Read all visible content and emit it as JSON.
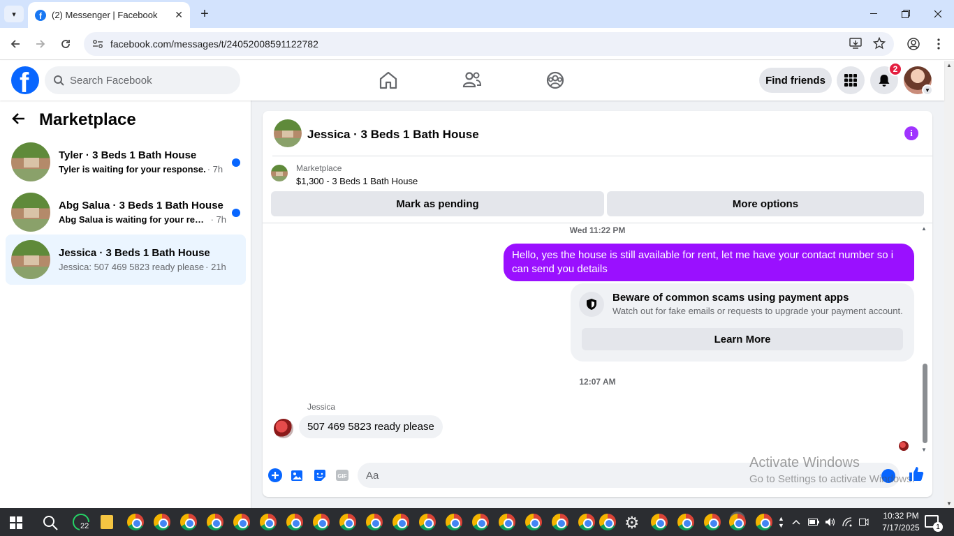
{
  "browser": {
    "tab_title": "(2) Messenger | Facebook",
    "url": "facebook.com/messages/t/24052008591122782",
    "new_tab_symbol": "+",
    "close_symbol": "✕"
  },
  "fb_header": {
    "logo_letter": "f",
    "search_placeholder": "Search Facebook",
    "find_friends": "Find friends",
    "notification_count": "2"
  },
  "left_pane": {
    "title": "Marketplace",
    "conversations": [
      {
        "name": "Tyler · 3 Beds 1 Bath House",
        "preview": "Tyler is waiting for your response.",
        "time": "· 7h",
        "unread": true
      },
      {
        "name": "Abg Salua · 3 Beds 1 Bath House",
        "preview": "Abg Salua is waiting for your resp...",
        "time": "· 7h",
        "unread": true
      },
      {
        "name": "Jessica · 3 Beds 1 Bath House",
        "preview": "Jessica: 507 469 5823 ready please",
        "time": "· 21h",
        "unread": false,
        "active": true
      }
    ]
  },
  "chat": {
    "title": "Jessica · 3 Beds 1 Bath House",
    "marketplace_label": "Marketplace",
    "listing": "$1,300 - 3 Beds 1 Bath House",
    "mark_pending": "Mark as pending",
    "more_options": "More options",
    "timestamp_1": "Wed 11:22 PM",
    "outgoing_message": "Hello, yes the house is still available for rent, let me have your contact number so i can send you  details",
    "scam_title": "Beware of common scams using payment apps",
    "scam_text": "Watch out for fake emails or requests to upgrade your payment account.",
    "learn_more": "Learn More",
    "timestamp_2": "12:07 AM",
    "sender_name": "Jessica",
    "incoming_message": "507 469 5823 ready please",
    "composer_placeholder": "Aa",
    "gif_label": "GIF"
  },
  "watermark": {
    "line1": "Activate Windows",
    "line2": "Go to Settings to activate Windows."
  },
  "taskbar": {
    "whatsapp_badge": "22",
    "time": "10:32 PM",
    "date": "7/17/2025",
    "notification_badge": "1"
  },
  "colors": {
    "fb_blue": "#0866ff",
    "outgoing_bubble": "#9a10ff",
    "unread_dot": "#0866ff",
    "notification_red": "#e41e3f"
  }
}
